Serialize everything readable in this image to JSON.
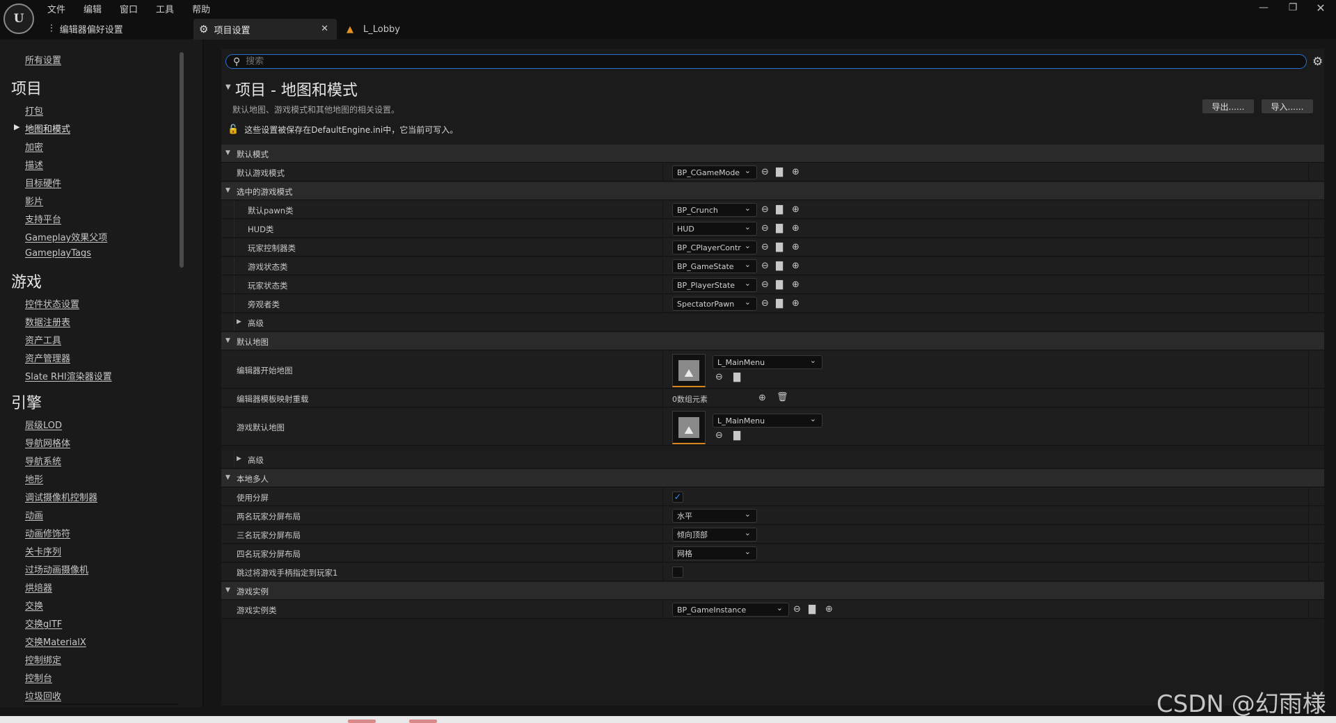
{
  "menu": [
    "文件",
    "编辑",
    "窗口",
    "工具",
    "帮助"
  ],
  "logo_text": "U",
  "window_controls": {
    "minimize": "—",
    "restore": "❐",
    "close": "✕"
  },
  "pref_tab": {
    "label": "编辑器偏好设置",
    "icon": "sliders-icon"
  },
  "tabs": [
    {
      "label": "项目设置",
      "close": "✕",
      "icon": "settings-icon"
    },
    {
      "label": "L_Lobby",
      "icon": "level-icon"
    }
  ],
  "sidebar": {
    "all_settings": "所有设置",
    "sections": [
      {
        "title": "项目",
        "items": [
          "打包",
          "地图和模式",
          "加密",
          "描述",
          "目标硬件",
          "影片",
          "支持平台",
          "Gameplay效果父项",
          "GameplayTags"
        ]
      },
      {
        "title": "游戏",
        "items": [
          "控件状态设置",
          "数据注册表",
          "资产工具",
          "资产管理器",
          "Slate RHI渲染器设置"
        ]
      },
      {
        "title": "引擎",
        "items": [
          "层级LOD",
          "导航网格体",
          "导航系统",
          "地形",
          "调试摄像机控制器",
          "动画",
          "动画修饰符",
          "关卡序列",
          "过场动画摄像机",
          "烘焙器",
          "交换",
          "交换glTF",
          "交换MaterialX",
          "控制绑定",
          "控制台",
          "垃圾回收"
        ]
      }
    ],
    "selected": "地图和模式"
  },
  "search": {
    "placeholder": "搜索"
  },
  "page": {
    "title": "项目 - 地图和模式",
    "description": "默认地图、游戏模式和其他地图的相关设置。",
    "lock_notice": "这些设置被保存在DefaultEngine.ini中，它当前可写入。",
    "export_label": "导出......",
    "import_label": "导入......"
  },
  "settings": {
    "default_modes": {
      "category": "默认模式",
      "game_mode_label": "默认游戏模式",
      "game_mode_value": "BP_CGameMode",
      "selected_category": "选中的游戏模式",
      "pawn_label": "默认pawn类",
      "pawn_value": "BP_Crunch",
      "hud_label": "HUD类",
      "hud_value": "HUD",
      "pc_label": "玩家控制器类",
      "pc_value": "BP_CPlayerController",
      "gs_label": "游戏状态类",
      "gs_value": "BP_GameState",
      "ps_label": "玩家状态类",
      "ps_value": "BP_PlayerState",
      "spec_label": "旁观者类",
      "spec_value": "SpectatorPawn",
      "advanced": "高级"
    },
    "default_maps": {
      "category": "默认地图",
      "editor_start_label": "编辑器开始地图",
      "editor_start_value": "L_MainMenu",
      "template_label": "编辑器模板映射重载",
      "template_count": "0数组元素",
      "game_default_label": "游戏默认地图",
      "game_default_value": "L_MainMenu",
      "advanced": "高级"
    },
    "local_multiplayer": {
      "category": "本地多人",
      "split_label": "使用分屏",
      "split_checked": true,
      "two_label": "两名玩家分屏布局",
      "two_value": "水平",
      "three_label": "三名玩家分屏布局",
      "three_value": "倾向顶部",
      "four_label": "四名玩家分屏布局",
      "four_value": "网格",
      "skip_label": "跳过将游戏手柄指定到玩家1",
      "skip_checked": false
    },
    "game_instance": {
      "category": "游戏实例",
      "class_label": "游戏实例类",
      "class_value": "BP_GameInstance"
    }
  },
  "watermark": "CSDN @幻雨様",
  "colors": {
    "accent_blue": "#2c6fd6",
    "thumb_orange": "#d8861c",
    "level_icon": "#e39224"
  }
}
